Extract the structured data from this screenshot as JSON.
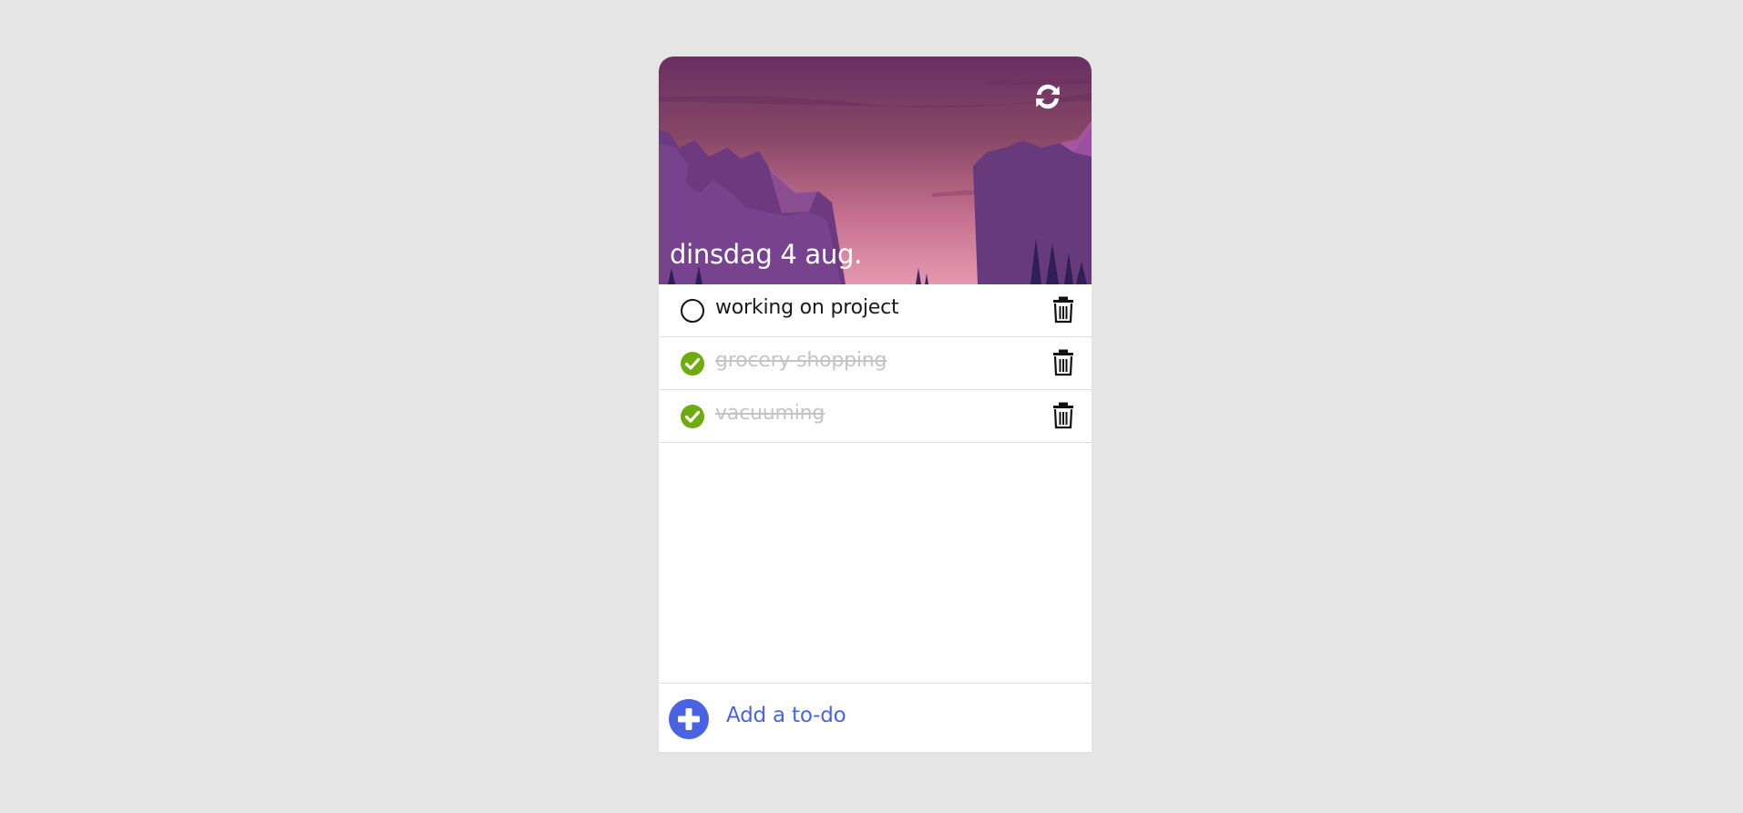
{
  "header": {
    "date_label": "dinsdag 4 aug.",
    "refresh_icon": "refresh-icon",
    "background_colors": {
      "sky_top": "#6e3566",
      "sky_bottom": "#e08aa8",
      "mountains": "#6a3a7c",
      "trees": "#2e1f55"
    }
  },
  "todos": [
    {
      "text": "working on project",
      "done": false
    },
    {
      "text": "grocery shopping",
      "done": true
    },
    {
      "text": "vacuuming",
      "done": true
    }
  ],
  "footer": {
    "add_label": "Add a to-do",
    "add_icon": "plus-circle-icon"
  },
  "colors": {
    "accent": "#4a63e0",
    "done_check": "#6eab0e",
    "done_text": "#c4c4c4",
    "divider": "#dedede",
    "page_background": "#e5e5e5"
  }
}
